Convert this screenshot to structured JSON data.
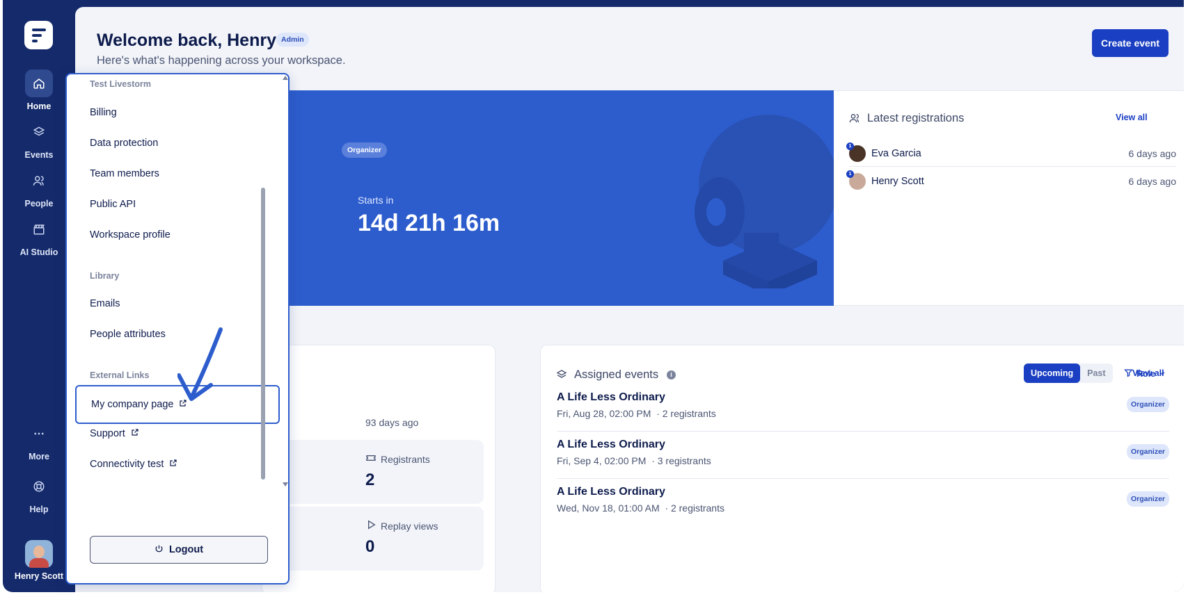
{
  "sidebar": {
    "items": [
      {
        "label": "Home",
        "icon": "home-icon",
        "active": true
      },
      {
        "label": "Events",
        "icon": "layers-icon",
        "active": false
      },
      {
        "label": "People",
        "icon": "people-icon",
        "active": false
      },
      {
        "label": "AI Studio",
        "icon": "clapper-icon",
        "active": false
      }
    ],
    "more_label": "More",
    "help_label": "Help",
    "user_name": "Henry Scott"
  },
  "header": {
    "welcome": "Welcome back, Henry",
    "role_badge": "Admin",
    "subtitle": "Here's what's happening across your workspace.",
    "create_button": "Create event"
  },
  "hero": {
    "role": "Organizer",
    "starts_in_label": "Starts in",
    "countdown": "14d 21h 16m"
  },
  "latest_registrations": {
    "title": "Latest registrations",
    "view_all": "View all",
    "rows": [
      {
        "name": "Eva Garcia",
        "time": "6 days ago"
      },
      {
        "name": "Henry Scott",
        "time": "6 days ago"
      }
    ]
  },
  "stats_card": {
    "ago": "93 days ago",
    "registrants_label": "Registrants",
    "registrants_value": "2",
    "replay_label": "Replay views",
    "replay_value": "0"
  },
  "assigned_events": {
    "title": "Assigned events",
    "info": "i",
    "tab_upcoming": "Upcoming",
    "tab_past": "Past",
    "role_filter": "Role",
    "view_all": "View all",
    "rows": [
      {
        "name": "A Life Less Ordinary",
        "date": "Fri, Aug 28, 02:00 PM",
        "registrants": "· 2 registrants",
        "badge": "Organizer"
      },
      {
        "name": "A Life Less Ordinary",
        "date": "Fri, Sep 4, 02:00 PM",
        "registrants": "· 3 registrants",
        "badge": "Organizer"
      },
      {
        "name": "A Life Less Ordinary",
        "date": "Wed, Nov 18, 01:00 AM",
        "registrants": "· 2 registrants",
        "badge": "Organizer"
      }
    ]
  },
  "dropdown": {
    "workspace_section": "Test Livestorm",
    "workspace_items": [
      "Billing",
      "Data protection",
      "Team members",
      "Public API",
      "Workspace profile"
    ],
    "library_section": "Library",
    "library_items": [
      "Emails",
      "People attributes"
    ],
    "external_section": "External Links",
    "external_items": [
      "My company page",
      "Support",
      "Connectivity test"
    ],
    "logout": "Logout"
  },
  "colors": {
    "navy": "#142a6b",
    "accent": "#1a3fc2",
    "hero": "#2d5dcd"
  }
}
